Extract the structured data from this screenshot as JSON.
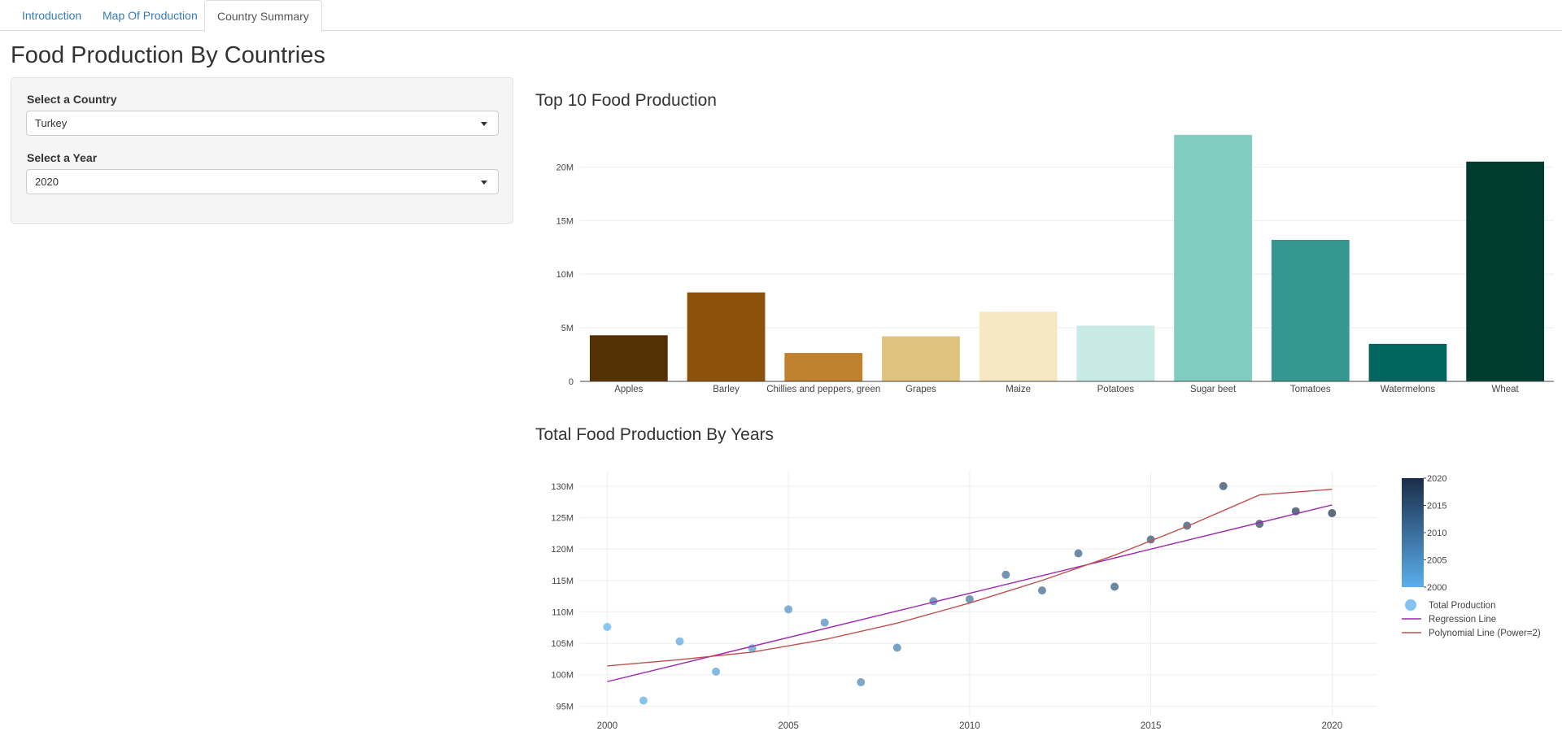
{
  "tabs": [
    {
      "label": "Introduction"
    },
    {
      "label": "Map Of Production"
    },
    {
      "label": "Country Summary"
    }
  ],
  "page_title": "Food Production By Countries",
  "sidebar": {
    "country_label": "Select a Country",
    "country_value": "Turkey",
    "year_label": "Select a Year",
    "year_value": "2020"
  },
  "bar_section_title": "Top 10 Food Production",
  "scatter_section_title": "Total Food Production By Years",
  "chart_data": [
    {
      "type": "bar",
      "title": "Top 10 Food Production",
      "categories": [
        "Apples",
        "Barley",
        "Chillies and peppers, green",
        "Grapes",
        "Maize",
        "Potatoes",
        "Sugar beet",
        "Tomatoes",
        "Watermelons",
        "Wheat"
      ],
      "values": [
        4300000,
        8300000,
        2650000,
        4200000,
        6500000,
        5200000,
        23000000,
        13200000,
        3500000,
        20500000
      ],
      "colors": [
        "#543005",
        "#8c510a",
        "#bf812d",
        "#dfc27d",
        "#f6e8c3",
        "#c7eae5",
        "#80cdc1",
        "#35978f",
        "#01665e",
        "#003c30"
      ],
      "yticks": [
        0,
        5000000,
        10000000,
        15000000,
        20000000
      ],
      "ytick_labels": [
        "0",
        "5M",
        "10M",
        "15M",
        "20M"
      ],
      "ylim": [
        0,
        24200000
      ],
      "grid": true
    },
    {
      "type": "scatter",
      "title": "Total Food Production By Years",
      "x": [
        2000,
        2001,
        2002,
        2003,
        2004,
        2005,
        2006,
        2007,
        2008,
        2009,
        2010,
        2011,
        2012,
        2013,
        2014,
        2015,
        2016,
        2017,
        2018,
        2019,
        2020
      ],
      "y": [
        107.6,
        95.9,
        105.3,
        100.5,
        104.2,
        110.4,
        108.3,
        98.8,
        104.3,
        111.7,
        112.0,
        115.9,
        113.4,
        119.3,
        114.0,
        121.5,
        123.7,
        130.0,
        124.0,
        126.0,
        125.7
      ],
      "y_unit": "M",
      "xlim": [
        1999.25,
        2021.25
      ],
      "ylim": [
        93.5,
        132.3
      ],
      "xticks": [
        2000,
        2005,
        2010,
        2015,
        2020
      ],
      "xtick_labels": [
        "2000",
        "2005",
        "2010",
        "2015",
        "2020"
      ],
      "yticks": [
        95,
        100,
        105,
        110,
        115,
        120,
        125,
        130
      ],
      "ytick_labels": [
        "95M",
        "100M",
        "105M",
        "110M",
        "115M",
        "120M",
        "125M",
        "130M"
      ],
      "color_scale": {
        "min": 2000,
        "max": 2020,
        "low_color": "#5aaeec",
        "high_color": "#1a2d48",
        "ticks": [
          "2000",
          "2005",
          "2010",
          "2015",
          "2020"
        ]
      },
      "lines": [
        {
          "name": "Regression Line",
          "color": "#9c27b0",
          "x": [
            2000,
            2020
          ],
          "y": [
            98.9,
            127.0
          ]
        },
        {
          "name": "Polynomial Line (Power=2)",
          "color": "#c0504d",
          "x": [
            2000,
            2002,
            2004,
            2006,
            2008,
            2010,
            2012,
            2014,
            2016,
            2018,
            2020
          ],
          "y": [
            101.4,
            102.4,
            103.6,
            105.6,
            108.2,
            111.4,
            115.0,
            119.0,
            123.6,
            128.6,
            129.5
          ]
        }
      ],
      "legend": {
        "position": "right",
        "items": [
          "Total Production",
          "Regression Line",
          "Polynomial Line (Power=2)"
        ]
      },
      "grid": true
    }
  ]
}
